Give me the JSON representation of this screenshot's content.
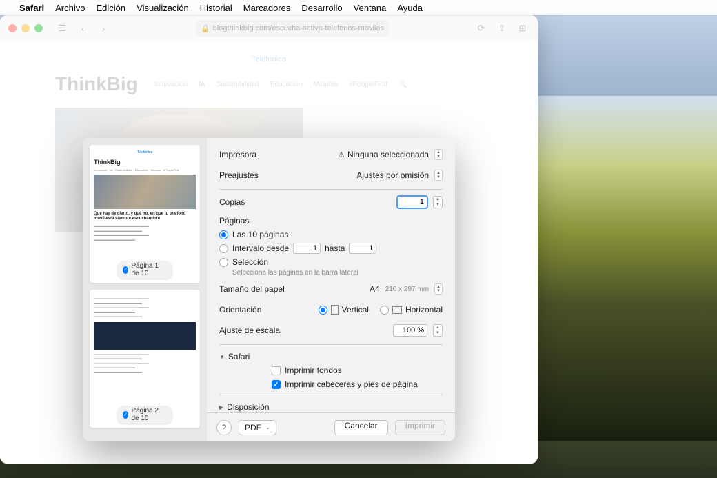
{
  "menubar": {
    "apple": "",
    "app": "Safari",
    "items": [
      "Archivo",
      "Edición",
      "Visualización",
      "Historial",
      "Marcadores",
      "Desarrollo",
      "Ventana",
      "Ayuda"
    ]
  },
  "safari": {
    "url": "blogthinkbig.com/escucha-activa-telefonos-moviles",
    "brand": "Telefónica",
    "logo": "ThinkBig",
    "nav": [
      "Innovación",
      "IA",
      "Sostenibilidad",
      "Educación",
      "Miradas",
      "#PeopleFirst"
    ],
    "article_title": "Qué hay de cierto, y qué no, en que tu teléfono móvil está siempre escuchándote"
  },
  "preview": {
    "page1_badge": "Página 1 de 10",
    "page2_badge": "Página 2 de 10"
  },
  "dialog": {
    "printer_label": "Impresora",
    "printer_value": "Ninguna seleccionada",
    "presets_label": "Preajustes",
    "presets_value": "Ajustes por omisión",
    "copies_label": "Copias",
    "copies_value": "1",
    "pages_label": "Páginas",
    "pages_all": "Las 10 páginas",
    "pages_range": "Intervalo desde",
    "pages_range_from": "1",
    "pages_range_to_label": "hasta",
    "pages_range_to": "1",
    "pages_selection": "Selección",
    "pages_selection_help": "Selecciona las páginas en la barra lateral",
    "paper_label": "Tamaño del papel",
    "paper_value": "A4",
    "paper_dim": "210 x 297 mm",
    "orientation_label": "Orientación",
    "orientation_vertical": "Vertical",
    "orientation_horizontal": "Horizontal",
    "scale_label": "Ajuste de escala",
    "scale_value": "100 %",
    "safari_section": "Safari",
    "print_backgrounds": "Imprimir fondos",
    "print_headers": "Imprimir cabeceras y pies de página",
    "layout_section": "Disposición",
    "help": "?",
    "pdf": "PDF",
    "cancel": "Cancelar",
    "print": "Imprimir"
  }
}
